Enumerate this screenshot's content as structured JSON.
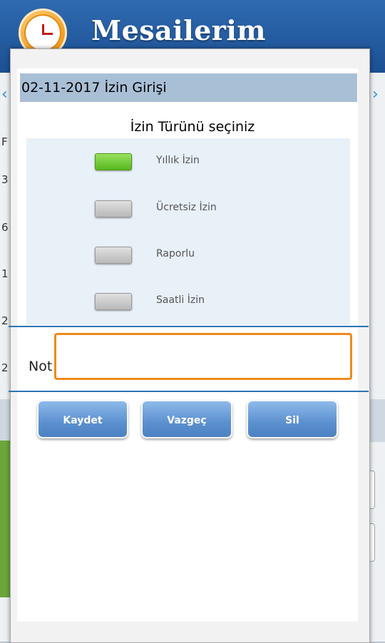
{
  "app": {
    "title": "Mesailerim"
  },
  "background": {
    "cells": [
      "F",
      "3",
      "6",
      "1",
      "2",
      "2"
    ]
  },
  "dialog": {
    "title": "02-11-2017 İzin Girişi",
    "prompt": "İzin Türünü seçiniz",
    "leave_types": [
      {
        "label": "Yıllık İzin",
        "selected": true
      },
      {
        "label": "Ücretsiz İzin",
        "selected": false
      },
      {
        "label": "Raporlu",
        "selected": false
      },
      {
        "label": "Saatli İzin",
        "selected": false
      }
    ],
    "note_label": "Not",
    "note_value": "",
    "buttons": {
      "save": "Kaydet",
      "cancel": "Vazgeç",
      "delete": "Sil"
    }
  },
  "colors": {
    "header": "#1c4f92",
    "accent_focus": "#ef8a1a",
    "toggle_on": "#56b81f",
    "title_bar": "#a9bfd6"
  }
}
